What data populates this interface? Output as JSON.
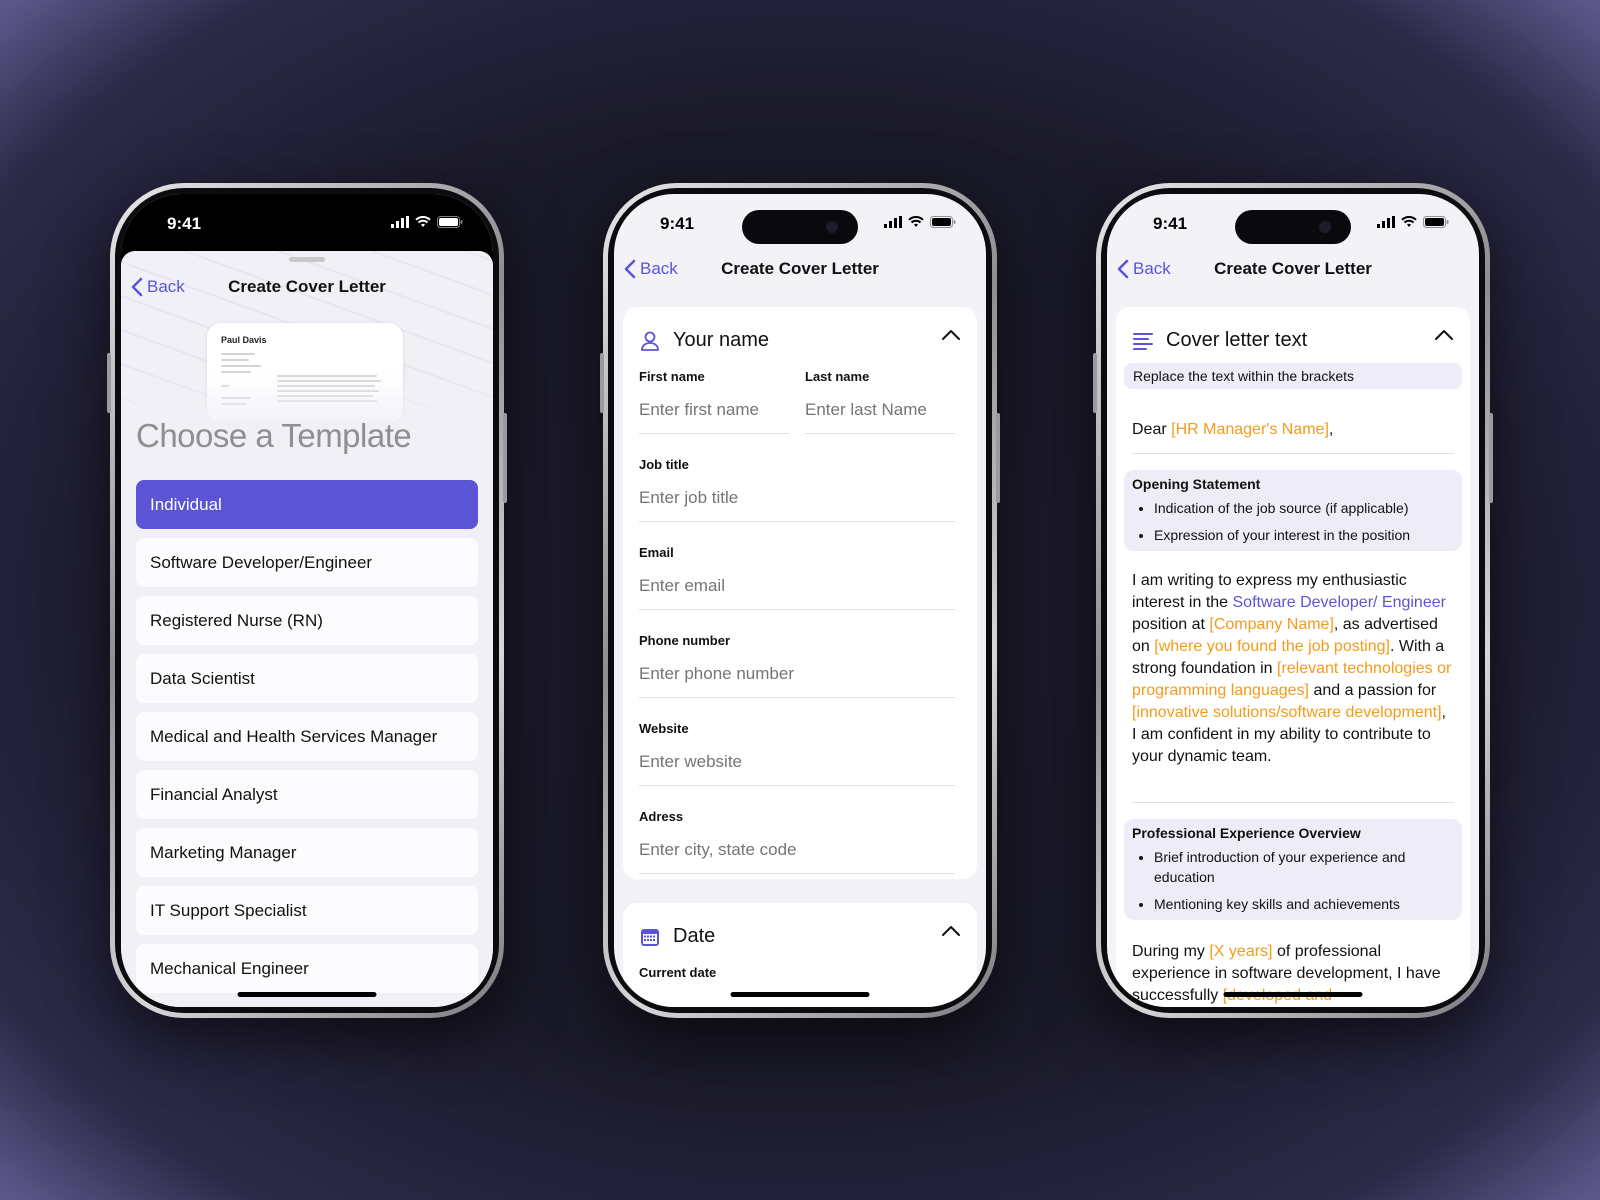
{
  "status": {
    "time": "9:41"
  },
  "nav": {
    "back_label": "Back",
    "title": "Create Cover Letter"
  },
  "phone1": {
    "preview_name": "Paul Davis",
    "heading": "Choose a Template",
    "templates": [
      {
        "label": "Individual",
        "selected": true
      },
      {
        "label": "Software Developer/Engineer",
        "selected": false
      },
      {
        "label": "Registered Nurse (RN)",
        "selected": false
      },
      {
        "label": "Data Scientist",
        "selected": false
      },
      {
        "label": "Medical and Health Services Manager",
        "selected": false
      },
      {
        "label": "Financial Analyst",
        "selected": false
      },
      {
        "label": "Marketing Manager",
        "selected": false
      },
      {
        "label": "IT Support Specialist",
        "selected": false
      },
      {
        "label": "Mechanical Engineer",
        "selected": false
      }
    ]
  },
  "phone2": {
    "section_title": "Your name",
    "fields": {
      "first_name": {
        "label": "First name",
        "placeholder": "Enter first name"
      },
      "last_name": {
        "label": "Last name",
        "placeholder": "Enter last Name"
      },
      "job_title": {
        "label": "Job title",
        "placeholder": "Enter job title"
      },
      "email": {
        "label": "Email",
        "placeholder": "Enter email"
      },
      "phone": {
        "label": "Phone number",
        "placeholder": "Enter phone number"
      },
      "website": {
        "label": "Website",
        "placeholder": "Enter website"
      },
      "address": {
        "label": "Adress",
        "placeholder": "Enter city, state code"
      }
    },
    "date_section_title": "Date",
    "current_date_label": "Current date"
  },
  "phone3": {
    "section_title": "Cover letter text",
    "hint": "Replace the text within the brackets",
    "greeting": {
      "prefix": "Dear ",
      "placeholder": "[HR Manager's Name]",
      "suffix": ","
    },
    "opening": {
      "title": "Opening Statement",
      "bullets": [
        "Indication of the job source (if applicable)",
        "Expression of your interest in the position"
      ]
    },
    "paragraph1": {
      "t1": "I am writing to express my enthusiastic interest in the ",
      "role": "Software Developer/ Engineer",
      "t2": " position at ",
      "company": "[Company Name]",
      "t3": ", as advertised on ",
      "source": "[where you found the job posting]",
      "t4": ". With a strong foundation in ",
      "tech": "[relevant technologies or programming languages]",
      "t5": " and a passion for ",
      "passion": "[innovative solutions/software development]",
      "t6": ", I am confident in my ability to contribute to your dynamic team."
    },
    "experience": {
      "title": "Professional Experience Overview",
      "bullets": [
        "Brief introduction of your experience and education",
        "Mentioning key skills and achievements"
      ]
    },
    "paragraph2": {
      "t1": "During my ",
      "years": "[X years]",
      "t2": " of professional experience in software development, I have successfully ",
      "tail": "[developed and"
    }
  },
  "colors": {
    "accent": "#5b55d6",
    "placeholder_text": "#f29b1c"
  }
}
